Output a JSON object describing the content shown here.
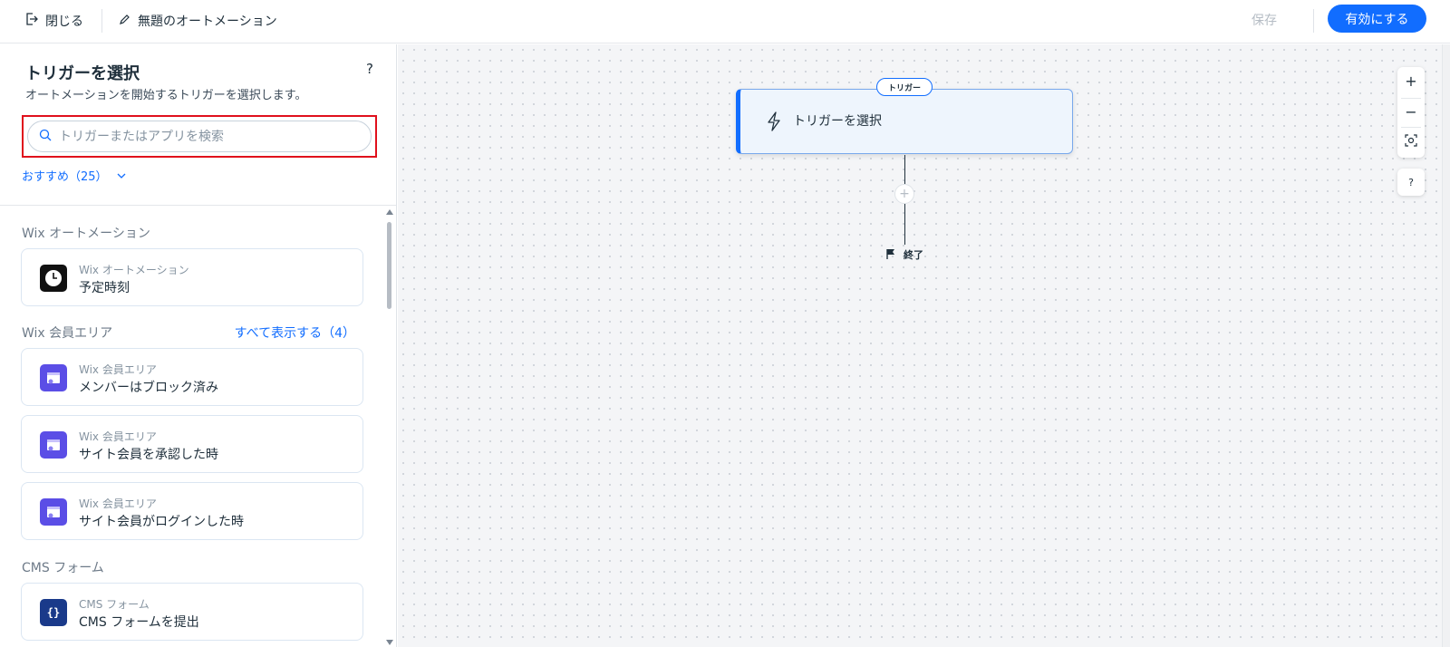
{
  "topbar": {
    "close_label": "閉じる",
    "title": "無題のオートメーション",
    "save_label": "保存",
    "enable_label": "有効にする"
  },
  "panel": {
    "title": "トリガーを選択",
    "help": "?",
    "subtitle": "オートメーションを開始するトリガーを選択します。",
    "search_placeholder": "トリガーまたはアプリを検索",
    "filter_label": "おすすめ（25）"
  },
  "sections": [
    {
      "title": "Wix オートメーション",
      "link": "",
      "items": [
        {
          "app": "Wix オートメーション",
          "name": "予定時刻",
          "icon": "clock-icon"
        }
      ]
    },
    {
      "title": "Wix 会員エリア",
      "link": "すべて表示する（4）",
      "items": [
        {
          "app": "Wix 会員エリア",
          "name": "メンバーはブロック済み",
          "icon": "members-area-icon"
        },
        {
          "app": "Wix 会員エリア",
          "name": "サイト会員を承認した時",
          "icon": "members-area-icon"
        },
        {
          "app": "Wix 会員エリア",
          "name": "サイト会員がログインした時",
          "icon": "members-area-icon"
        }
      ]
    },
    {
      "title": "CMS フォーム",
      "link": "",
      "items": [
        {
          "app": "CMS フォーム",
          "name": "CMS フォームを提出",
          "icon": "cms-form-icon"
        }
      ]
    }
  ],
  "canvas": {
    "trigger_badge": "トリガー",
    "trigger_label": "トリガーを選択",
    "add_symbol": "+",
    "end_label": "終了",
    "zoom_in": "+",
    "zoom_out": "−",
    "help": "?"
  },
  "colors": {
    "accent": "#116dff",
    "members_icon": "#5b4ee6",
    "cms_icon": "#1a3a8a",
    "highlight_frame": "#e0101c"
  }
}
